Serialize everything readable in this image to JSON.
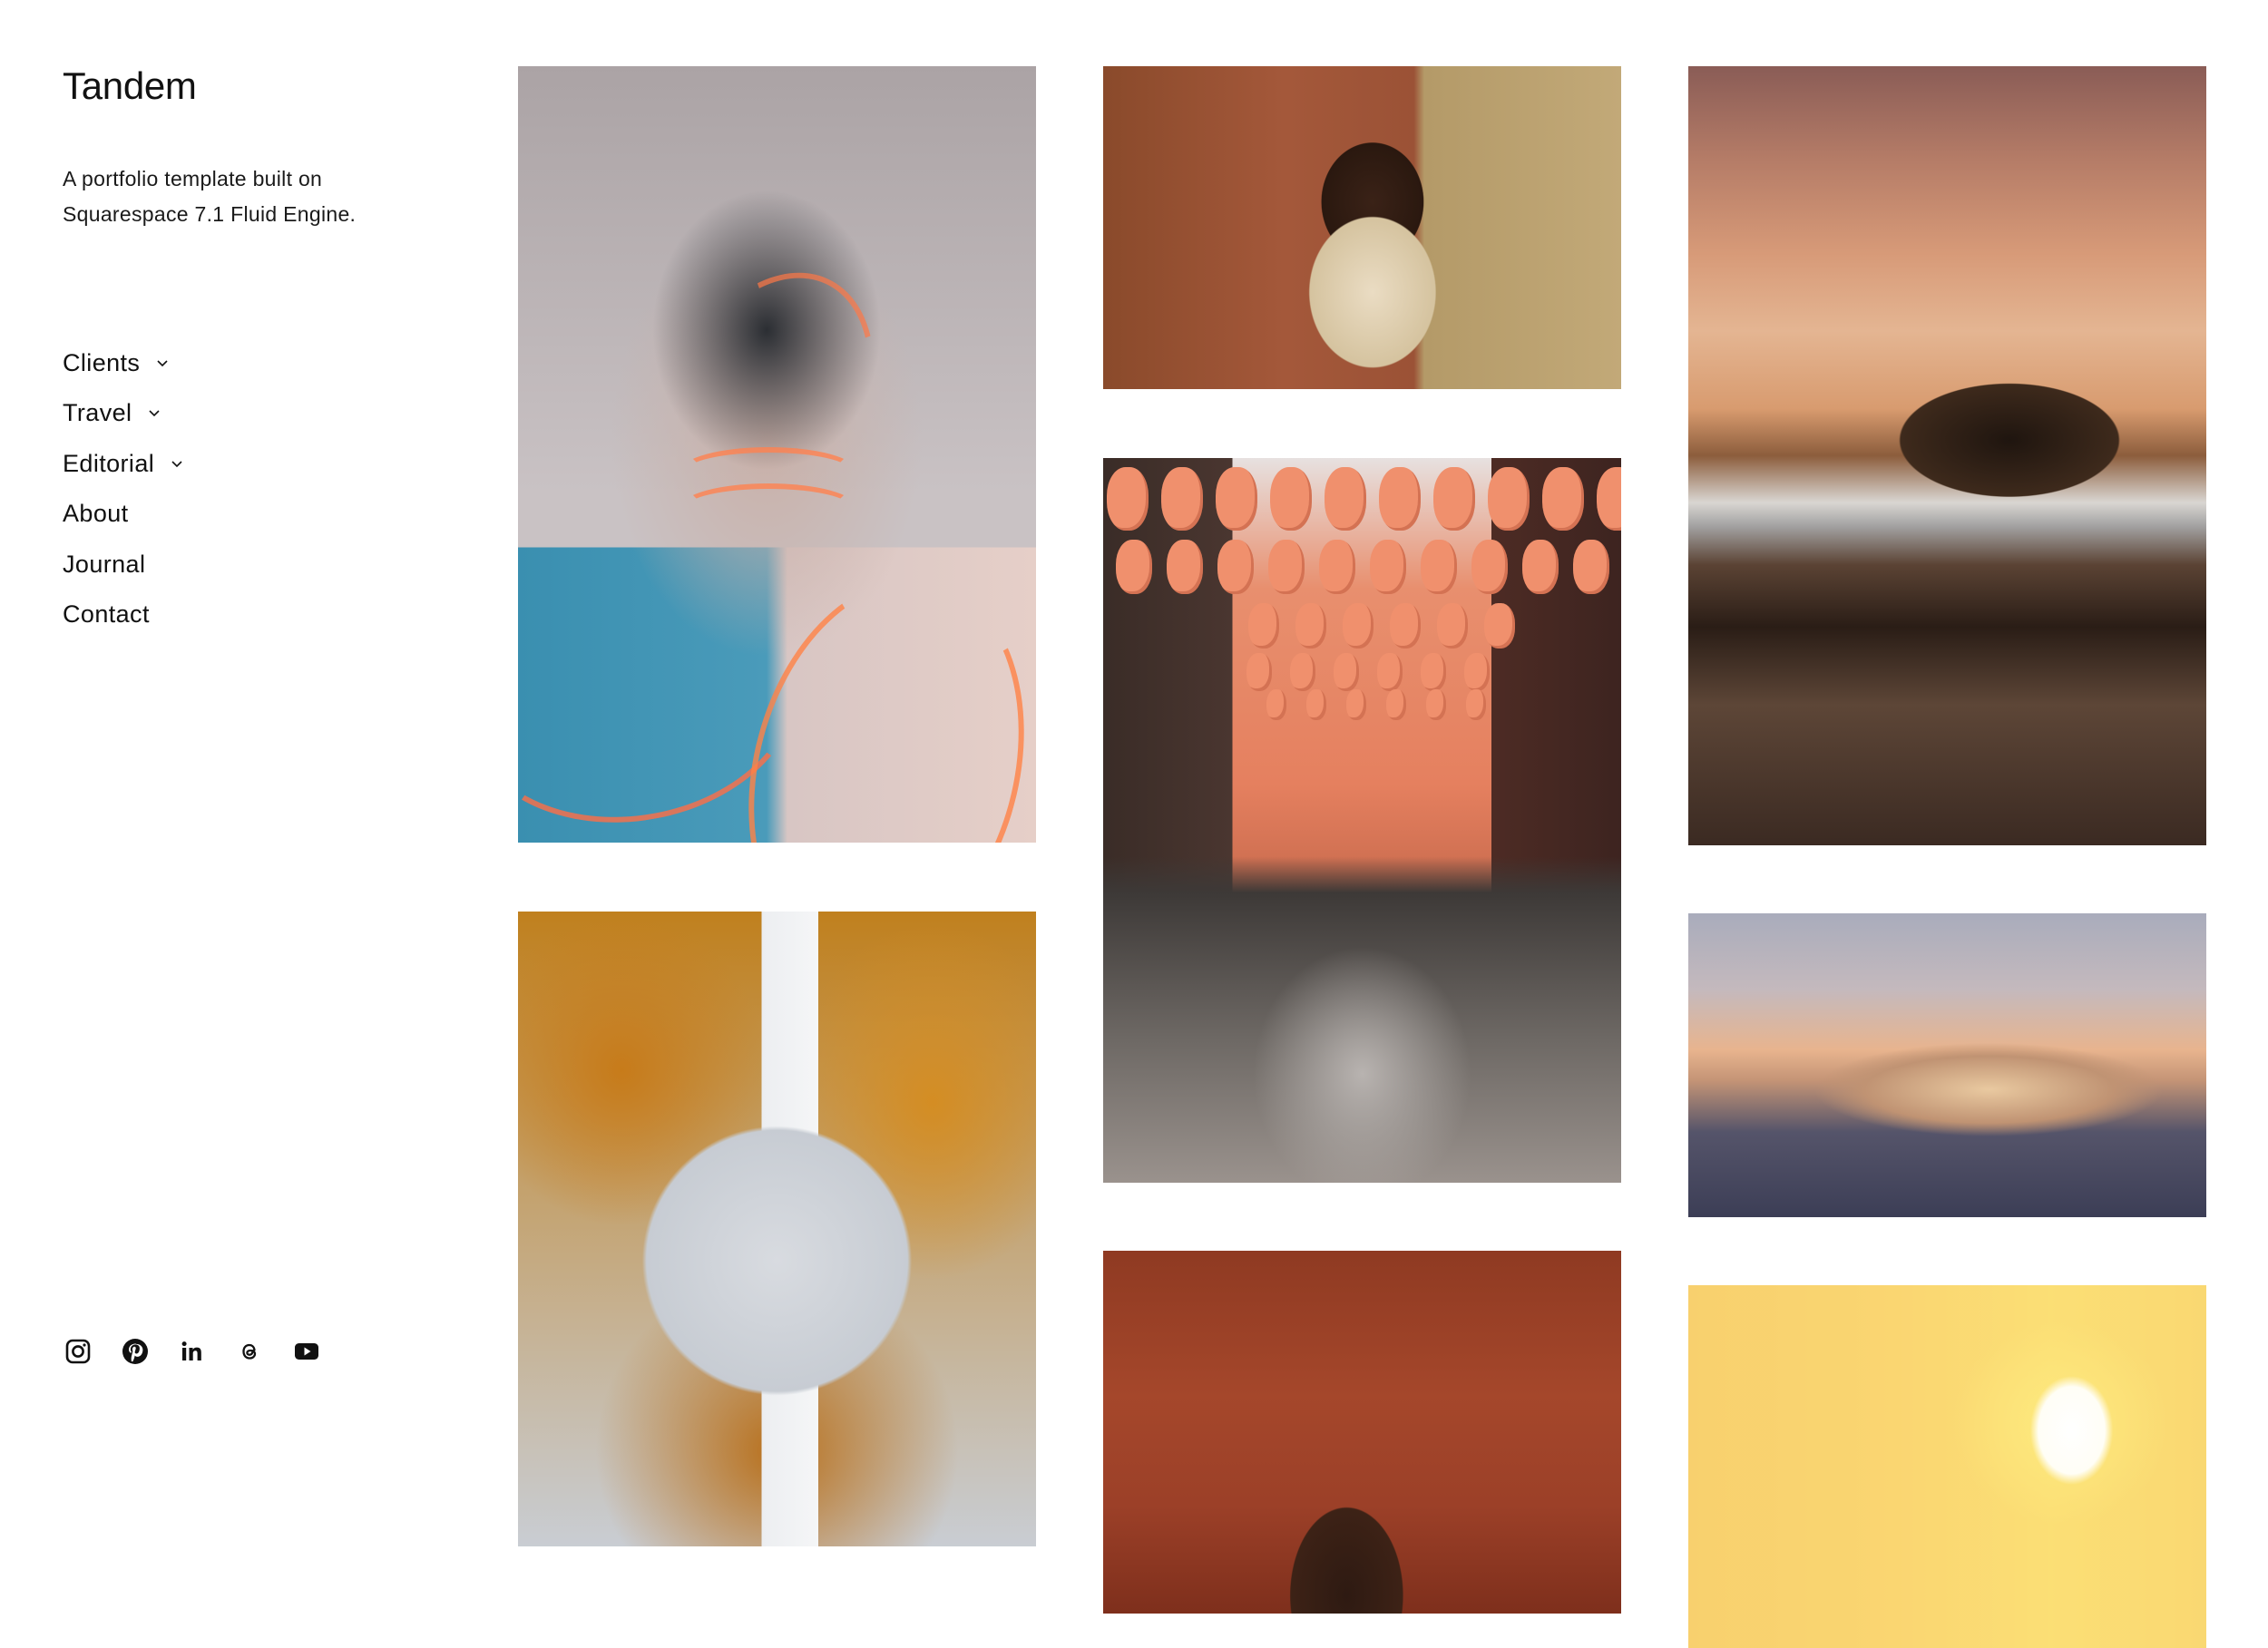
{
  "site": {
    "title": "Tandem",
    "tagline": "A portfolio template built on Squarespace 7.1 Fluid Engine."
  },
  "nav": {
    "items": [
      {
        "label": "Clients",
        "has_dropdown": true
      },
      {
        "label": "Travel",
        "has_dropdown": true
      },
      {
        "label": "Editorial",
        "has_dropdown": true
      },
      {
        "label": "About",
        "has_dropdown": false
      },
      {
        "label": "Journal",
        "has_dropdown": false
      },
      {
        "label": "Contact",
        "has_dropdown": false
      }
    ]
  },
  "social": [
    {
      "name": "Instagram",
      "icon": "instagram-icon"
    },
    {
      "name": "Pinterest",
      "icon": "pinterest-icon"
    },
    {
      "name": "LinkedIn",
      "icon": "linkedin-icon"
    },
    {
      "name": "Threads",
      "icon": "threads-icon"
    },
    {
      "name": "YouTube",
      "icon": "youtube-icon"
    }
  ],
  "gallery": {
    "columns": [
      [
        {
          "alt": "Portrait of a young man with orange light lines projected across face and shirt"
        },
        {
          "alt": "Autumn tree with orange leaves framing a white skyscraper"
        }
      ],
      [
        {
          "alt": "Woman with curly hair seated in a warm-toned room with a rust curtain"
        },
        {
          "alt": "City street lined with hanging red-orange paper lanterns"
        },
        {
          "alt": "Man against a red wall with arm raised over his head"
        }
      ],
      [
        {
          "alt": "Sunset over a coastal island with trees reflected on wet sand"
        },
        {
          "alt": "Snow-capped mountain range at golden hour"
        },
        {
          "alt": "Bright sun in an orange-yellow sky"
        }
      ]
    ]
  },
  "colors": {
    "text": "#111111",
    "background": "#ffffff"
  }
}
